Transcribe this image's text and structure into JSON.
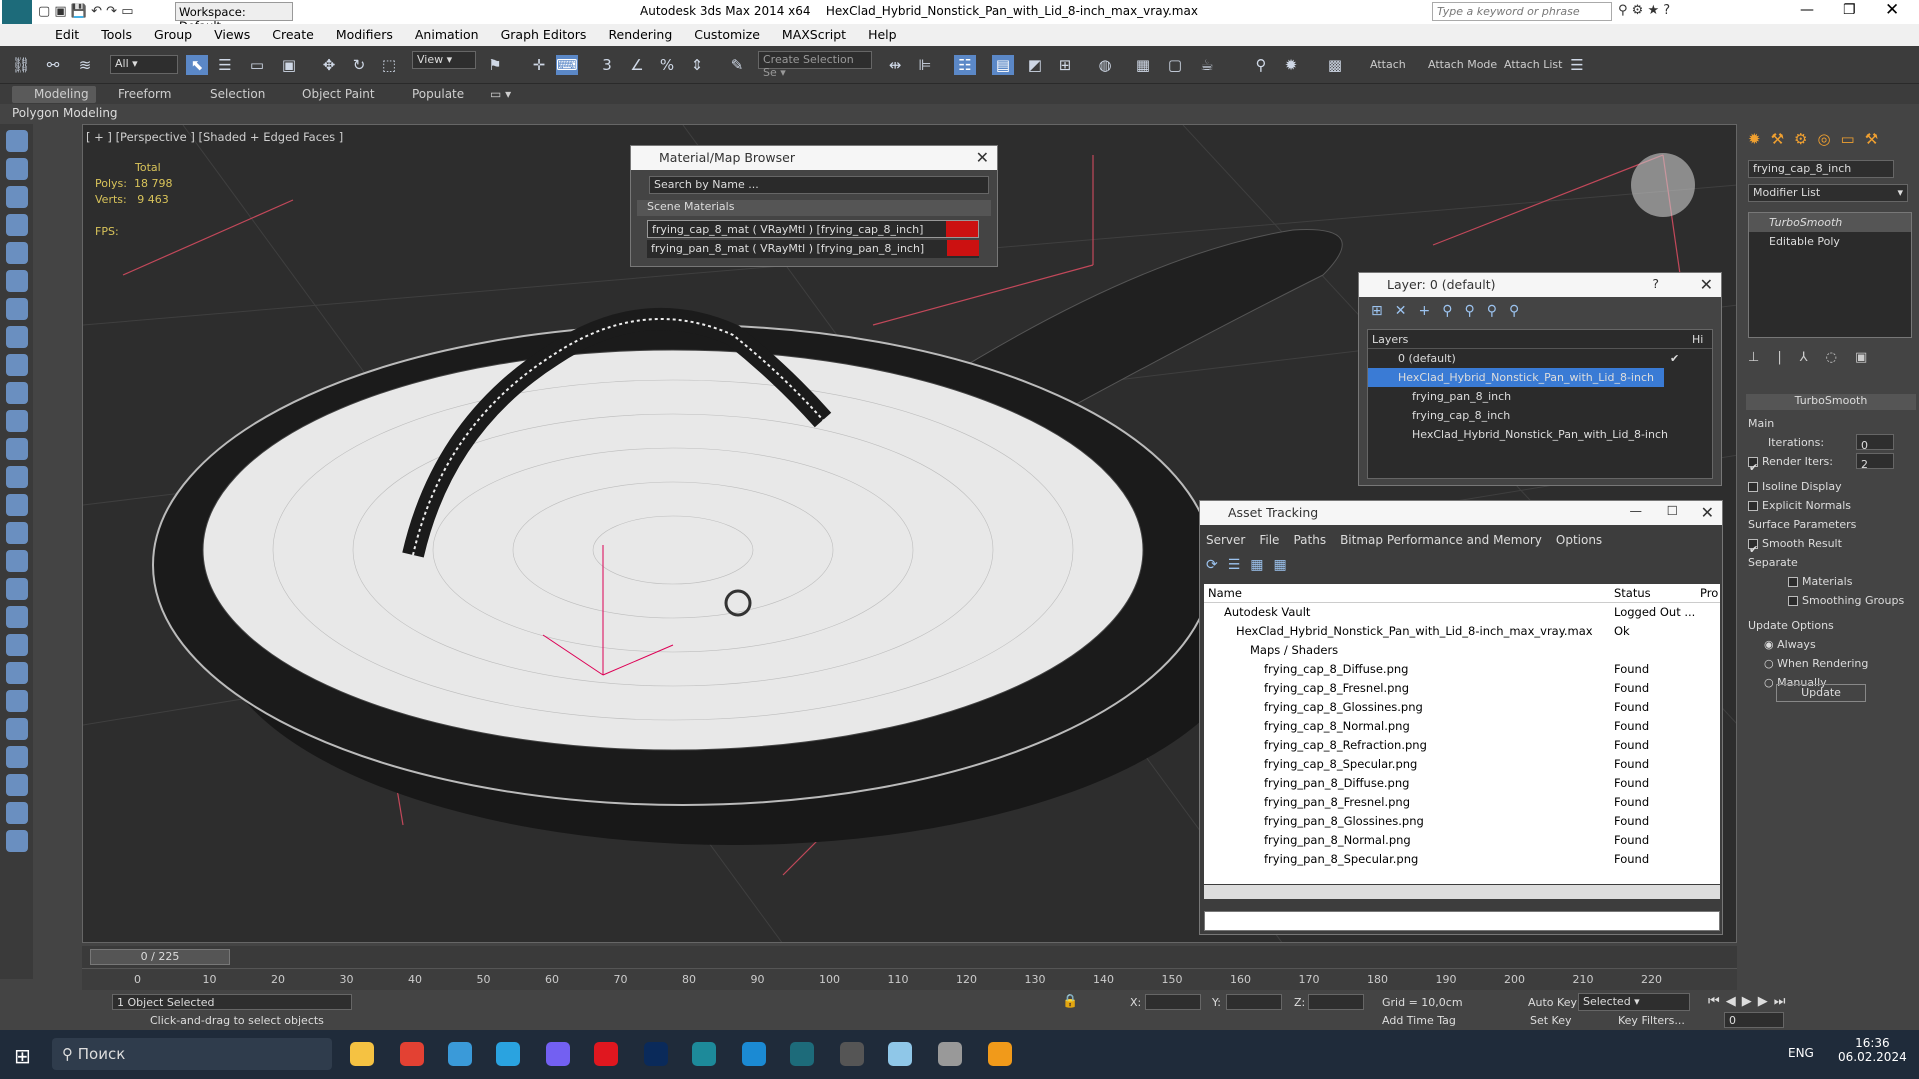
{
  "titlebar": {
    "workspace": "Workspace: Default",
    "app": "Autodesk 3ds Max  2014 x64",
    "file": "HexClad_Hybrid_Nonstick_Pan_with_Lid_8-inch_max_vray.max",
    "search_placeholder": "Type a keyword or phrase"
  },
  "menu": [
    "Edit",
    "Tools",
    "Group",
    "Views",
    "Create",
    "Modifiers",
    "Animation",
    "Graph Editors",
    "Rendering",
    "Customize",
    "MAXScript",
    "Help"
  ],
  "toolbar": {
    "filter": "All",
    "refcoord": "View",
    "selset_placeholder": "Create Selection Se",
    "attach": "Attach",
    "attach_mode": "Attach Mode",
    "attach_list": "Attach List"
  },
  "ribbon": {
    "tabs": [
      "Modeling",
      "Freeform",
      "Selection",
      "Object Paint",
      "Populate"
    ],
    "sub": "Polygon Modeling"
  },
  "viewport": {
    "label": "[ + ] [Perspective ] [Shaded + Edged Faces ]",
    "total": "Total",
    "polys_label": "Polys:",
    "polys": "18 798",
    "verts_label": "Verts:",
    "verts": "9 463",
    "fps": "FPS:"
  },
  "matbrowser": {
    "title": "Material/Map Browser",
    "search": "Search by Name ...",
    "section": "Scene Materials",
    "items": [
      "frying_cap_8_mat  ( VRayMtl ) [frying_cap_8_inch]",
      "frying_pan_8_mat  ( VRayMtl ) [frying_pan_8_inch]"
    ]
  },
  "layer": {
    "title": "Layer: 0 (default)",
    "col1": "Layers",
    "col2": "Hi",
    "rows": [
      "0 (default)",
      "HexClad_Hybrid_Nonstick_Pan_with_Lid_8-inch",
      "frying_pan_8_inch",
      "frying_cap_8_inch",
      "HexClad_Hybrid_Nonstick_Pan_with_Lid_8-inch"
    ]
  },
  "asset": {
    "title": "Asset Tracking",
    "menu": [
      "Server",
      "File",
      "Paths",
      "Bitmap Performance and Memory",
      "Options"
    ],
    "col_name": "Name",
    "col_status": "Status",
    "col_pro": "Pro",
    "rows": [
      {
        "name": "Autodesk Vault",
        "status": "Logged Out ..."
      },
      {
        "name": "HexClad_Hybrid_Nonstick_Pan_with_Lid_8-inch_max_vray.max",
        "status": "Ok"
      },
      {
        "name": "Maps / Shaders",
        "status": ""
      },
      {
        "name": "frying_cap_8_Diffuse.png",
        "status": "Found"
      },
      {
        "name": "frying_cap_8_Fresnel.png",
        "status": "Found"
      },
      {
        "name": "frying_cap_8_Glossines.png",
        "status": "Found"
      },
      {
        "name": "frying_cap_8_Normal.png",
        "status": "Found"
      },
      {
        "name": "frying_cap_8_Refraction.png",
        "status": "Found"
      },
      {
        "name": "frying_cap_8_Specular.png",
        "status": "Found"
      },
      {
        "name": "frying_pan_8_Diffuse.png",
        "status": "Found"
      },
      {
        "name": "frying_pan_8_Fresnel.png",
        "status": "Found"
      },
      {
        "name": "frying_pan_8_Glossines.png",
        "status": "Found"
      },
      {
        "name": "frying_pan_8_Normal.png",
        "status": "Found"
      },
      {
        "name": "frying_pan_8_Specular.png",
        "status": "Found"
      }
    ]
  },
  "cmdpanel": {
    "object_name": "frying_cap_8_inch",
    "modifier_list": "Modifier List",
    "stack": [
      "TurboSmooth",
      "Editable Poly"
    ],
    "rollout": "TurboSmooth",
    "main": "Main",
    "iterations_label": "Iterations:",
    "iterations": "0",
    "render_iters_label": "Render Iters:",
    "render_iters": "2",
    "isoline": "Isoline Display",
    "explicit": "Explicit Normals",
    "surface": "Surface Parameters",
    "smooth": "Smooth Result",
    "separate": "Separate",
    "materials": "Materials",
    "smoothing": "Smoothing Groups",
    "update_opts": "Update Options",
    "always": "Always",
    "when_rendering": "When Rendering",
    "manually": "Manually",
    "update_btn": "Update"
  },
  "timeline": {
    "frame": "0 / 225",
    "ticks": [
      "0",
      "10",
      "20",
      "30",
      "40",
      "50",
      "60",
      "70",
      "80",
      "90",
      "100",
      "110",
      "120",
      "130",
      "140",
      "150",
      "160",
      "170",
      "180",
      "190",
      "200",
      "210",
      "220"
    ]
  },
  "status": {
    "selected": "1 Object Selected",
    "prompt": "Click-and-drag to select objects",
    "x": "X:",
    "y": "Y:",
    "z": "Z:",
    "grid": "Grid = 10,0cm",
    "autokey": "Auto Key",
    "selected_mode": "Selected",
    "setkey": "Set Key",
    "keyfilters": "Key Filters...",
    "add_time_tag": "Add Time Tag",
    "frame_val": "0"
  },
  "taskbar": {
    "search": "Поиск",
    "lang": "ENG",
    "time": "16:36",
    "date": "06.02.2024"
  }
}
